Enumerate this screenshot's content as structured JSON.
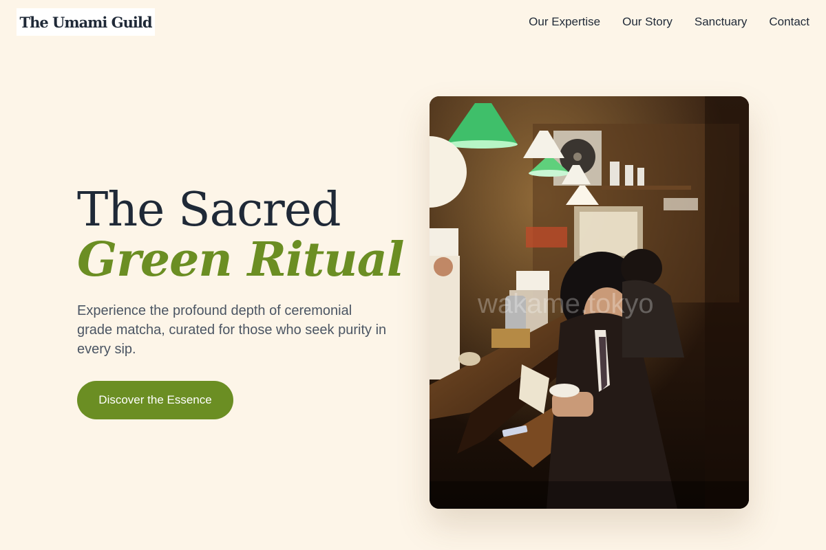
{
  "brand": {
    "name": "The Umami Guild"
  },
  "nav": {
    "items": [
      {
        "label": "Our Expertise"
      },
      {
        "label": "Our Story"
      },
      {
        "label": "Sanctuary"
      },
      {
        "label": "Contact"
      }
    ]
  },
  "hero": {
    "title_line1": "The Sacred",
    "title_line2": "Green Ritual",
    "description": "Experience the profound depth of ceremonial grade matcha, curated for those who seek purity in every sip.",
    "cta_label": "Discover the Essence",
    "image_watermark": "wakame.tokyo"
  },
  "colors": {
    "background": "#fdf5e8",
    "accent": "#6b8e23",
    "text_dark": "#1f2937",
    "text_muted": "#4b5563"
  }
}
